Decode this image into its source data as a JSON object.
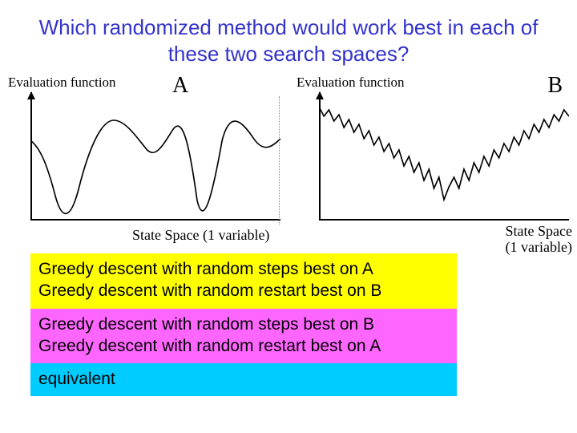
{
  "title": "Which randomized method would work best in each of these two search spaces?",
  "chartA": {
    "ylabel": "Evaluation function",
    "letter": "A",
    "xlabel": "State Space (1 variable)"
  },
  "chartB": {
    "ylabel": "Evaluation function",
    "letter": "B",
    "xlabel_line1": "State Space",
    "xlabel_line2": "(1 variable)"
  },
  "answers": {
    "a1_line1": "Greedy descent with random steps best on A",
    "a1_line2": "Greedy descent with random restart best on B",
    "a2_line1": "Greedy descent with random steps best on B",
    "a2_line2": "Greedy descent with random restart best on A",
    "a3_line1": "equivalent"
  },
  "chart_data": [
    {
      "type": "line",
      "title": "A",
      "xlabel": "State Space (1 variable)",
      "ylabel": "Evaluation function",
      "description": "Smooth curve with two deep, wide valleys and one shallow dip; few local minima.",
      "x": [
        0.0,
        0.05,
        0.08,
        0.12,
        0.16,
        0.2,
        0.24,
        0.3,
        0.35,
        0.4,
        0.45,
        0.5,
        0.55,
        0.6,
        0.65,
        0.7,
        0.73,
        0.76,
        0.8,
        0.85,
        0.9,
        0.93,
        0.97,
        1.0
      ],
      "values": [
        0.62,
        0.55,
        0.4,
        0.2,
        0.08,
        0.2,
        0.45,
        0.7,
        0.78,
        0.7,
        0.6,
        0.55,
        0.6,
        0.72,
        0.6,
        0.25,
        0.1,
        0.25,
        0.55,
        0.78,
        0.7,
        0.6,
        0.55,
        0.62
      ],
      "xlim": [
        0,
        1
      ],
      "ylim": [
        0,
        1
      ]
    },
    {
      "type": "line",
      "title": "B",
      "xlabel": "State Space (1 variable)",
      "ylabel": "Evaluation function",
      "description": "V-shaped global trend reaching a single global minimum near the center, with high-frequency jagged noise creating many tiny local minima.",
      "x": [
        0.0,
        0.05,
        0.1,
        0.15,
        0.2,
        0.25,
        0.3,
        0.35,
        0.4,
        0.45,
        0.5,
        0.55,
        0.6,
        0.65,
        0.7,
        0.75,
        0.8,
        0.85,
        0.9,
        0.95,
        1.0
      ],
      "trend_values": [
        0.9,
        0.82,
        0.74,
        0.66,
        0.58,
        0.5,
        0.42,
        0.34,
        0.26,
        0.18,
        0.1,
        0.18,
        0.26,
        0.34,
        0.42,
        0.5,
        0.58,
        0.66,
        0.74,
        0.82,
        0.9
      ],
      "noise_amplitude": 0.05,
      "xlim": [
        0,
        1
      ],
      "ylim": [
        0,
        1
      ]
    }
  ]
}
